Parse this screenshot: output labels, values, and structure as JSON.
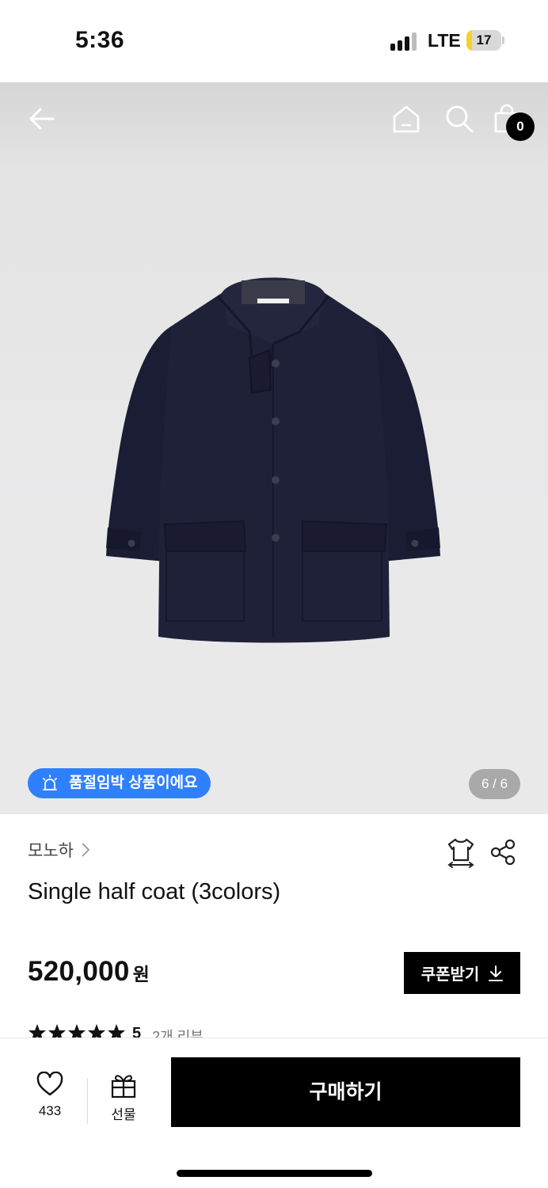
{
  "status_bar": {
    "time": "5:36",
    "network": "LTE",
    "battery": "17",
    "battery_level": 0.17
  },
  "header": {
    "cart_count": "0"
  },
  "gallery": {
    "badge": "품절임박 상품이에요",
    "page_indicator": "6 / 6"
  },
  "product": {
    "brand": "모노하",
    "title": "Single half coat (3colors)",
    "price": "520,000",
    "currency": "원",
    "coupon_label": "쿠폰받기",
    "rating": "5",
    "review_count_label": "2개 리뷰"
  },
  "bottom_bar": {
    "like_count": "433",
    "gift_label": "선물",
    "buy_label": "구매하기"
  },
  "colors": {
    "accent": "#2f80ff",
    "coat": "#1a1c33",
    "button": "#000000"
  },
  "icons": [
    "back-icon",
    "home-icon",
    "search-icon",
    "bag-icon",
    "alarm-icon",
    "chevron-right-icon",
    "size-guide-icon",
    "share-icon",
    "download-icon",
    "star-icon",
    "heart-icon",
    "gift-icon"
  ]
}
